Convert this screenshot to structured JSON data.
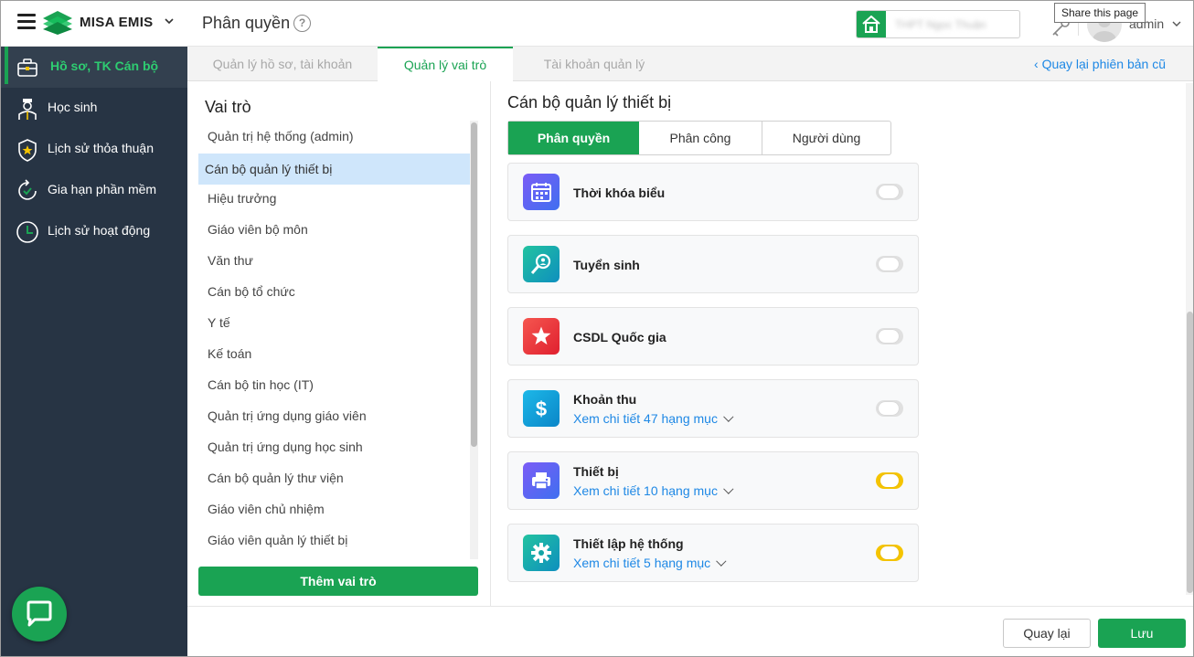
{
  "header": {
    "brand": "MISA EMIS",
    "page_title": "Phân quyền",
    "help_icon": "?",
    "school_name": "THPT Ngọc Thuận",
    "share_tooltip": "Share this page",
    "username": "admin"
  },
  "sidebar": {
    "items": [
      {
        "label": "Hồ sơ, TK Cán bộ",
        "icon": "briefcase-icon",
        "active": true
      },
      {
        "label": "Học sinh",
        "icon": "student-icon",
        "active": false
      },
      {
        "label": "Lịch sử thỏa thuận",
        "icon": "shield-star-icon",
        "active": false
      },
      {
        "label": "Gia hạn phần mềm",
        "icon": "renew-icon",
        "active": false
      },
      {
        "label": "Lịch sử hoạt động",
        "icon": "clock-icon",
        "active": false
      }
    ]
  },
  "tabs": [
    {
      "label": "Quản lý hồ sơ, tài khoản",
      "active": false
    },
    {
      "label": "Quản lý vai trò",
      "active": true
    },
    {
      "label": "Tài khoản quản lý",
      "active": false
    }
  ],
  "back_link": "Quay lại phiên bản cũ",
  "roles": {
    "title": "Vai trò",
    "items": [
      "Quản trị hệ thống (admin)",
      "Cán bộ quản lý thiết bị",
      "Hiệu trưởng",
      "Giáo viên bộ môn",
      "Văn thư",
      "Cán bộ tổ chức",
      "Y tế",
      "Kế toán",
      "Cán bộ tin học (IT)",
      "Quản trị ứng dụng giáo viên",
      "Quản trị ứng dụng học sinh",
      "Cán bộ quản lý thư viện",
      "Giáo viên chủ nhiệm",
      "Giáo viên quản lý thiết bị"
    ],
    "selected_index": 1,
    "add_button": "Thêm vai trò"
  },
  "detail": {
    "title": "Cán bộ quản lý thiết bị",
    "subtabs": [
      "Phân quyền",
      "Phân công",
      "Người dùng"
    ],
    "permissions": [
      {
        "name": "Thời khóa biểu",
        "link": "",
        "enabled": false,
        "icon": "calendar-icon",
        "color": "#5b5ef0"
      },
      {
        "name": "Tuyển sinh",
        "link": "",
        "enabled": false,
        "icon": "search-person-icon",
        "color": "#15a89a"
      },
      {
        "name": "CSDL Quốc gia",
        "link": "",
        "enabled": false,
        "icon": "star-icon",
        "color": "#ef3b3b"
      },
      {
        "name": "Khoản thu",
        "link": "Xem chi tiết 47 hạng mục",
        "enabled": false,
        "icon": "dollar-icon",
        "color": "#1499d6"
      },
      {
        "name": "Thiết bị",
        "link": "Xem chi tiết 10 hạng mục",
        "enabled": true,
        "icon": "printer-icon",
        "color": "#5b5ef0"
      },
      {
        "name": "Thiết lập hệ thống",
        "link": "Xem chi tiết 5 hạng mục",
        "enabled": true,
        "icon": "gear-icon",
        "color": "#15a89a"
      }
    ]
  },
  "footer": {
    "back_label": "Quay lại",
    "save_label": "Lưu"
  },
  "colors": {
    "brand_green": "#1aa353",
    "sidebar_bg": "#273444",
    "link_blue": "#1e88e5",
    "toggle_on": "#f5c400"
  }
}
